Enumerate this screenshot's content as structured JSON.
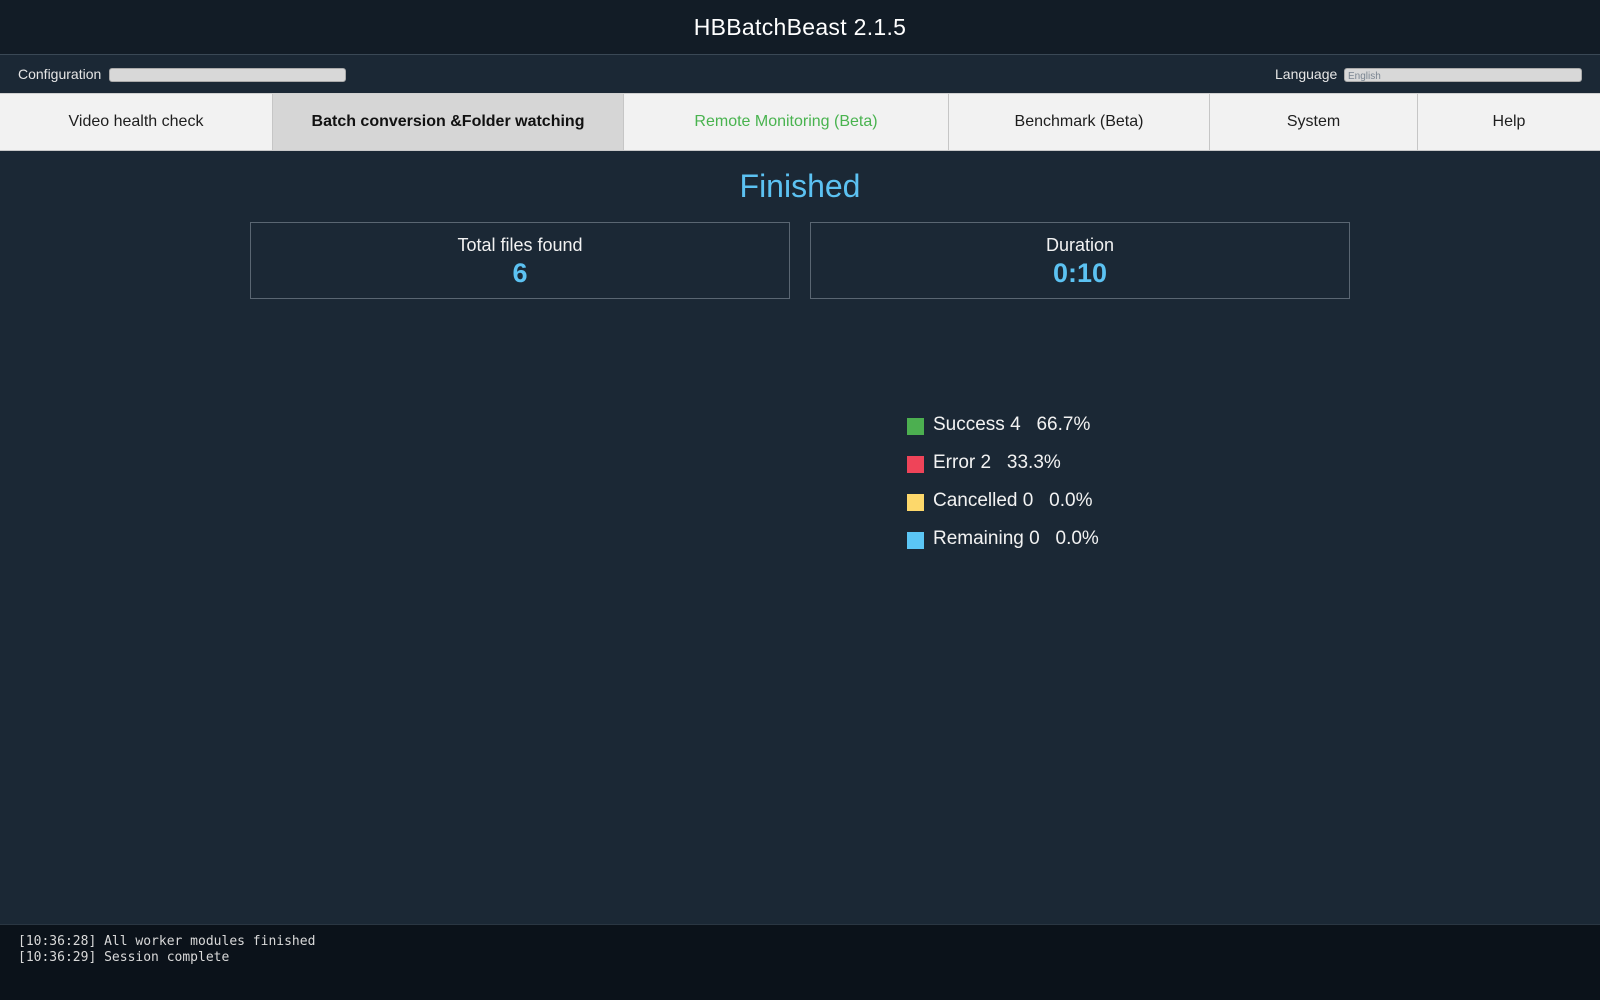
{
  "window": {
    "title": "HBBatchBeast 2.1.5"
  },
  "config_bar": {
    "configuration_label": "Configuration",
    "configuration_value": "",
    "language_label": "Language",
    "language_value": "English"
  },
  "tabs": [
    {
      "label": "Video health check",
      "active": false
    },
    {
      "label": "Batch conversion &Folder watching",
      "active": true
    },
    {
      "label": "Remote Monitoring (Beta)",
      "active": false,
      "color": "#49b34f"
    },
    {
      "label": "Benchmark (Beta)",
      "active": false
    },
    {
      "label": "System",
      "active": false
    },
    {
      "label": "Help",
      "active": false
    }
  ],
  "status": {
    "title": "Finished"
  },
  "stats": {
    "total_files_label": "Total files found",
    "total_files_value": "6",
    "duration_label": "Duration",
    "duration_value": "0:10"
  },
  "legend": [
    {
      "name": "Success",
      "count": 4,
      "percent": "66.7%",
      "color": "#4caf50"
    },
    {
      "name": "Error",
      "count": 2,
      "percent": "33.3%",
      "color": "#ef4459"
    },
    {
      "name": "Cancelled",
      "count": 0,
      "percent": "0.0%",
      "color": "#fdd86b"
    },
    {
      "name": "Remaining",
      "count": 0,
      "percent": "0.0%",
      "color": "#5bc6f5"
    }
  ],
  "log": [
    "[10:36:28] All worker modules finished",
    "[10:36:29] Session complete"
  ],
  "colors": {
    "accent": "#5cc2f2",
    "background": "#1b2835",
    "title_bar": "#121c26",
    "log_background": "#0b121a"
  }
}
